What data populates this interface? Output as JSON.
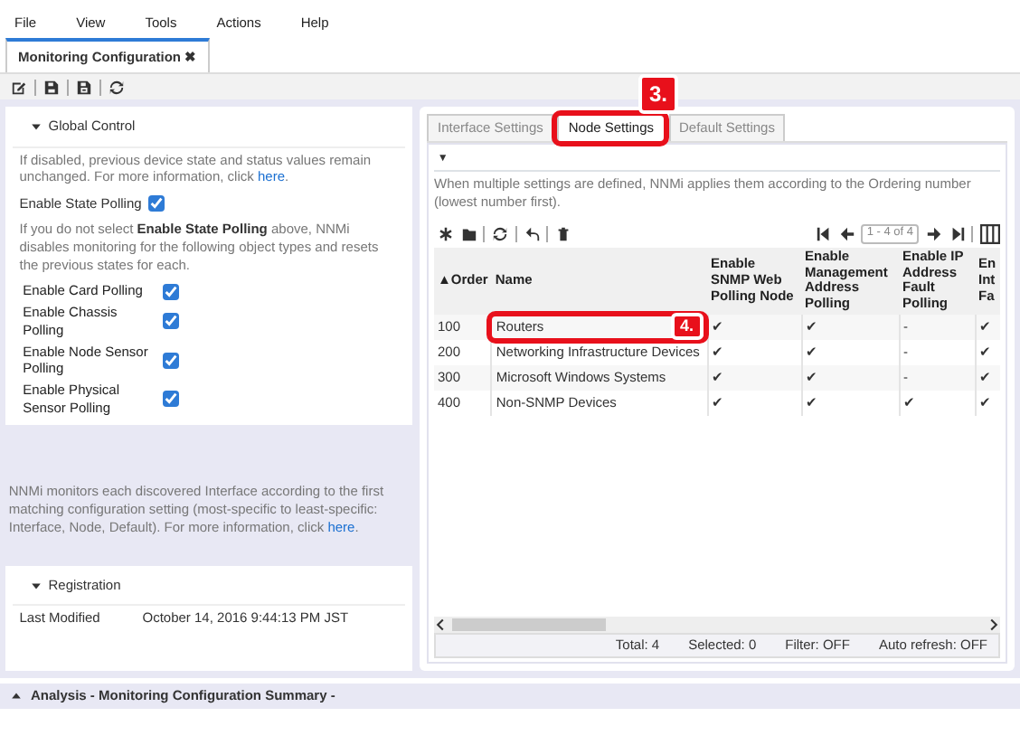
{
  "menu": [
    "File",
    "View",
    "Tools",
    "Actions",
    "Help"
  ],
  "doc_tab": {
    "label": "Monitoring Configuration",
    "close": "✖",
    "selected": true
  },
  "left": {
    "global_control": {
      "title": "Global Control",
      "expanded": true,
      "intro": {
        "text": "If disabled, previous device state and status values remain unchanged. For more information, click",
        "link": "here",
        "after": "."
      },
      "state_polling": {
        "label": "Enable State Polling",
        "checked": true
      },
      "note": "If you do not select **Enable State Polling** above, NNMi disables monitoring for the following object types and resets the previous states for each.",
      "options": [
        {
          "label": "Enable Card Polling",
          "checked": true
        },
        {
          "label": "Enable Chassis Polling",
          "checked": true
        },
        {
          "label": "Enable Node Sensor Polling",
          "checked": true
        },
        {
          "label": "Enable Physical Sensor Polling",
          "checked": true
        }
      ]
    },
    "interface_note": {
      "text": "NNMi monitors each discovered Interface according to the first matching configuration setting (most-specific to least-specific: Interface, Node, Default). For more information, click",
      "link": "here",
      "after": "."
    },
    "registration": {
      "title": "Registration",
      "expanded": true,
      "last_modified_label": "Last Modified",
      "last_modified": "October 14, 2016 9:44:13 PM JST"
    }
  },
  "right": {
    "tabs": [
      {
        "label": "Interface Settings",
        "selected": false
      },
      {
        "label": "Node Settings",
        "selected": true
      },
      {
        "label": "Default Settings",
        "selected": false
      }
    ],
    "filter_toggle": "▼",
    "description": "When multiple settings are defined, NNMi applies them according to the Ordering number (lowest number first).",
    "pager": "1 - 4 of 4",
    "table": {
      "columns": [
        "▲Order",
        "Name",
        "Enable SNMP Web Polling Node",
        "Enable Management Address Polling",
        "Enable IP Address Fault Polling",
        "En Int Fa"
      ],
      "rows": [
        [
          "100",
          "Routers",
          "✔",
          "✔",
          "-",
          "✔"
        ],
        [
          "200",
          "Networking Infrastructure Devices",
          "✔",
          "✔",
          "-",
          "✔"
        ],
        [
          "300",
          "Microsoft Windows Systems",
          "✔",
          "✔",
          "-",
          "✔"
        ],
        [
          "400",
          "Non-SNMP Devices",
          "✔",
          "✔",
          "✔",
          "✔"
        ]
      ]
    },
    "status": [
      "Total: 4",
      "Selected: 0",
      "Filter: OFF",
      "Auto refresh: OFF"
    ]
  },
  "callouts": [
    {
      "label": "3.",
      "kind": "tab"
    },
    {
      "label": "4.",
      "kind": "row"
    }
  ],
  "bottom_panel": {
    "title": "Analysis - Monitoring Configuration Summary -",
    "expanded": false
  }
}
